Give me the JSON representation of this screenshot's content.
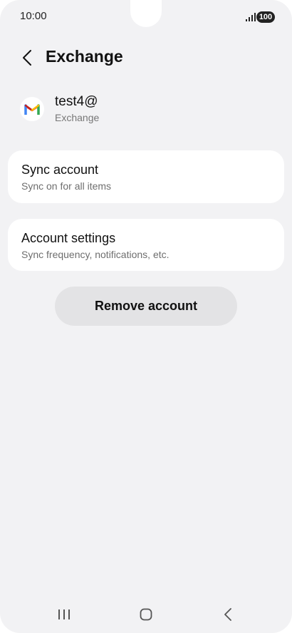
{
  "status_bar": {
    "time": "10:00",
    "battery": "100"
  },
  "header": {
    "title": "Exchange"
  },
  "account": {
    "name": "test4@",
    "type": "Exchange",
    "icon": "gmail-icon"
  },
  "cards": [
    {
      "title": "Sync account",
      "subtitle": "Sync on for all items"
    },
    {
      "title": "Account settings",
      "subtitle": "Sync frequency, notifications, etc."
    }
  ],
  "remove_button": {
    "label": "Remove account"
  },
  "nav_bar": {
    "icons": [
      "recent-apps-icon",
      "home-icon",
      "back-icon"
    ]
  },
  "colors": {
    "background": "#f2f2f4",
    "card": "#ffffff",
    "button": "#e3e3e5"
  }
}
